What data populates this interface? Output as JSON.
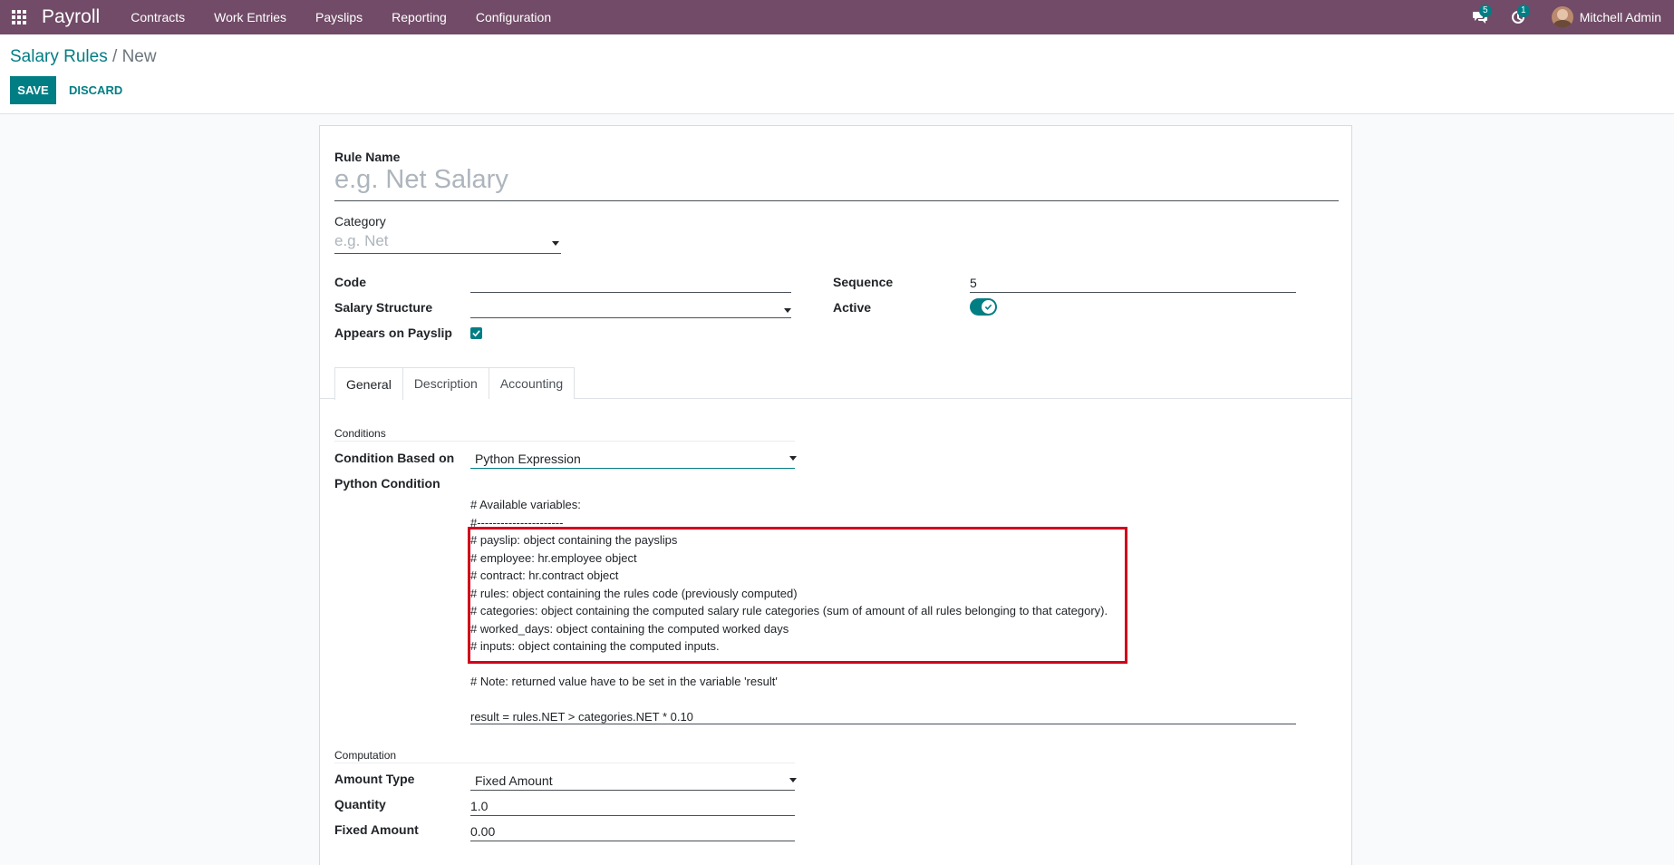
{
  "navbar": {
    "app_name": "Payroll",
    "menu": [
      "Contracts",
      "Work Entries",
      "Payslips",
      "Reporting",
      "Configuration"
    ],
    "messages_count": "5",
    "activities_count": "1",
    "user_name": "Mitchell Admin",
    "bg_color": "#714b67"
  },
  "breadcrumb": {
    "parent": "Salary Rules",
    "separator": " / ",
    "current": "New"
  },
  "actions": {
    "save": "SAVE",
    "discard": "DISCARD"
  },
  "form": {
    "rule_name": {
      "label": "Rule Name",
      "placeholder": "e.g. Net Salary"
    },
    "category": {
      "label": "Category",
      "placeholder": "e.g. Net"
    },
    "code": {
      "label": "Code",
      "value": ""
    },
    "salary_structure": {
      "label": "Salary Structure",
      "value": ""
    },
    "appears_on_payslip": {
      "label": "Appears on Payslip",
      "checked": true
    },
    "sequence": {
      "label": "Sequence",
      "value": "5"
    },
    "active": {
      "label": "Active",
      "on": true
    }
  },
  "tabs": [
    "General",
    "Description",
    "Accounting"
  ],
  "conditions": {
    "section_title": "Conditions",
    "condition_based_on": {
      "label": "Condition Based on",
      "value": "Python Expression"
    },
    "python_condition": {
      "label": "Python Condition",
      "lines": [
        "# Available variables:",
        "#----------------------",
        "# payslip: object containing the payslips",
        "# employee: hr.employee object",
        "# contract: hr.contract object",
        "# rules: object containing the rules code (previously computed)",
        "# categories: object containing the computed salary rule categories (sum of amount of all rules belonging to that category).",
        "# worked_days: object containing the computed worked days",
        "# inputs: object containing the computed inputs.",
        "",
        "# Note: returned value have to be set in the variable 'result'",
        "",
        "result = rules.NET > categories.NET * 0.10"
      ]
    }
  },
  "computation": {
    "section_title": "Computation",
    "amount_type": {
      "label": "Amount Type",
      "value": "Fixed Amount"
    },
    "quantity": {
      "label": "Quantity",
      "value": "1.0"
    },
    "fixed_amount": {
      "label": "Fixed Amount",
      "value": "0.00"
    }
  },
  "colors": {
    "accent": "#017e84",
    "highlight": "#d0021b"
  }
}
